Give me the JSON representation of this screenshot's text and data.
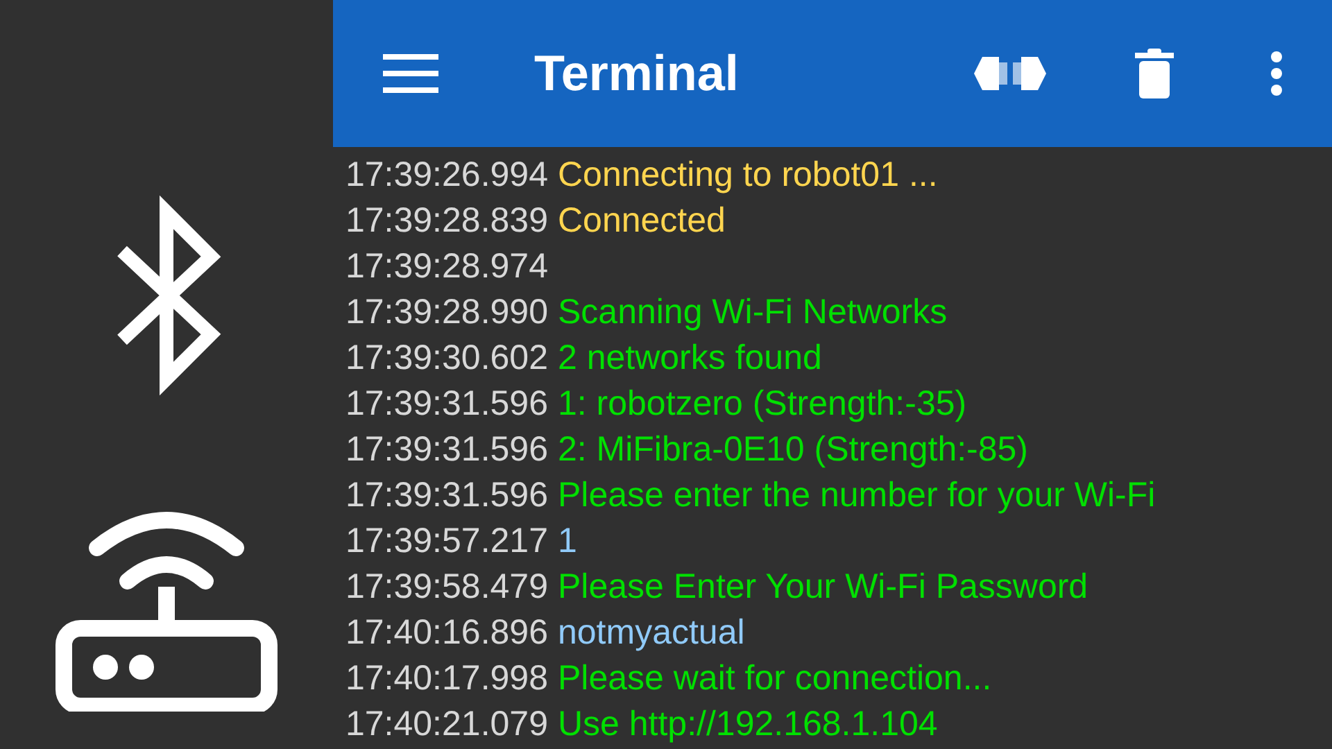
{
  "app_bar": {
    "title": "Terminal"
  },
  "log": [
    {
      "time": "17:39:26.994",
      "kind": "status",
      "message": "Connecting to robot01 ..."
    },
    {
      "time": "17:39:28.839",
      "kind": "status",
      "message": "Connected"
    },
    {
      "time": "17:39:28.974"
    },
    {
      "time": "17:39:28.990",
      "kind": "received",
      "message": "Scanning Wi-Fi Networks"
    },
    {
      "time": "17:39:30.602",
      "kind": "received",
      "message": "2 networks found"
    },
    {
      "time": "17:39:31.596",
      "kind": "received",
      "message": "1: robotzero (Strength:-35)"
    },
    {
      "time": "17:39:31.596",
      "kind": "received",
      "message": "2: MiFibra-0E10 (Strength:-85)"
    },
    {
      "time": "17:39:31.596",
      "kind": "received",
      "message": "Please enter the number for your Wi-Fi"
    },
    {
      "time": "17:39:57.217",
      "kind": "sent",
      "message": "1"
    },
    {
      "time": "17:39:58.479",
      "kind": "received",
      "message": "Please Enter Your Wi-Fi Password"
    },
    {
      "time": "17:40:16.896",
      "kind": "sent",
      "message": "notmyactual"
    },
    {
      "time": "17:40:17.998",
      "kind": "received",
      "message": "Please wait for connection..."
    },
    {
      "time": "17:40:21.079",
      "kind": "received",
      "message": "Use http://192.168.1.104"
    }
  ]
}
